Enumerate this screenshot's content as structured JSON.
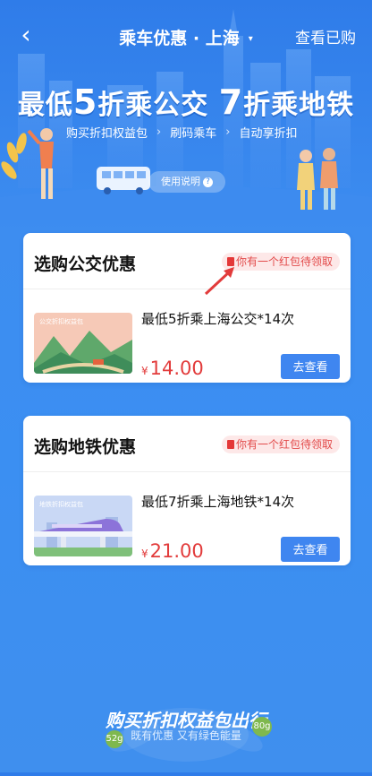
{
  "header": {
    "title": "乘车优惠 · 上海",
    "caret": "▾",
    "right_action": "查看已购",
    "back_icon": "‹"
  },
  "hero": {
    "headline_prefix": "最低",
    "headline_n1": "5",
    "headline_mid": "折乘公交",
    "headline_n2": "7",
    "headline_suffix": "折乘地铁",
    "steps": [
      "购买折扣权益包",
      "刷码乘车",
      "自动享折扣"
    ],
    "step_sep": "›",
    "instructions": "使用说明",
    "instructions_icon": "?"
  },
  "bus_card": {
    "title": "选购公交优惠",
    "badge": "你有一个红包待领取",
    "product_name": "最低5折乘上海公交*14次",
    "currency": "¥",
    "price": "14.00",
    "button": "去查看",
    "thumb_label": "公交折扣权益包"
  },
  "metro_card": {
    "title": "选购地铁优惠",
    "badge": "你有一个红包待领取",
    "product_name": "最低7折乘上海地铁*14次",
    "currency": "¥",
    "price": "21.00",
    "button": "去查看",
    "thumb_label": "地铁折扣权益包"
  },
  "footer": {
    "title": "购买折扣权益包出行",
    "subtitle": "既有优惠 又有绿色能量",
    "bubble_left": "52g",
    "bubble_right": "80g"
  },
  "colors": {
    "accent": "#3f86f0",
    "price": "#e23b3b",
    "badge_bg": "#fde8e8",
    "badge_text": "#e24a4a"
  }
}
